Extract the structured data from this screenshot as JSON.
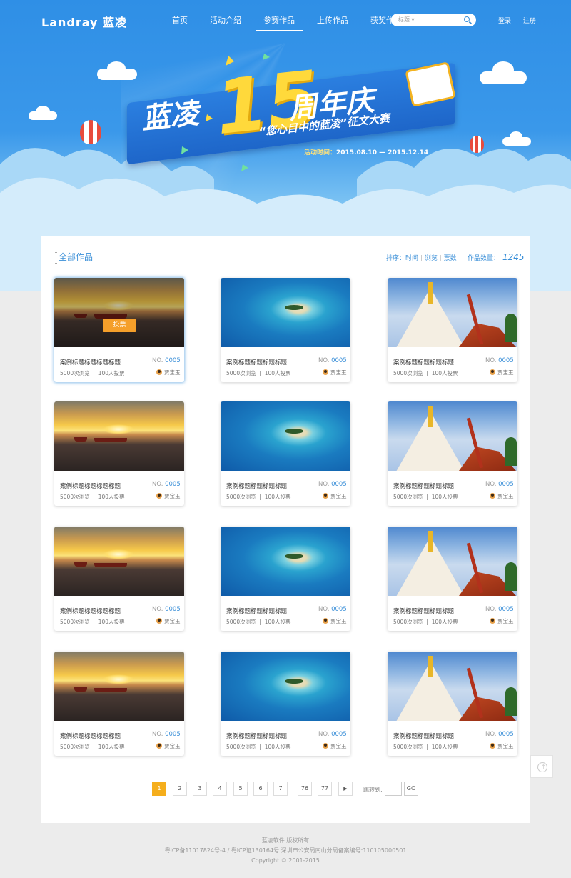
{
  "header": {
    "logo": "Landray 蓝凌",
    "nav": [
      "首页",
      "活动介绍",
      "参赛作品",
      "上传作品",
      "获奖作品"
    ],
    "active_nav": "参赛作品",
    "search": {
      "select_label": "标题 ▾",
      "placeholder": ""
    },
    "login": "登录",
    "separator": "|",
    "register": "注册"
  },
  "banner": {
    "title_left": "蓝凌",
    "title_number": "15",
    "title_right": "周年庆",
    "subtitle": "“您心目中的蓝凌”征文大赛",
    "date_label": "活动时间：",
    "date_range": "2015.08.10 — 2015.12.14"
  },
  "section": {
    "title": "全部作品",
    "sort_label": "排序：",
    "sort_time": "时间",
    "sort_views": "浏览",
    "sort_votes": "票数",
    "sort_sep": "|",
    "count_label": "作品数量：",
    "count_value": "1245"
  },
  "cards": [
    {
      "title": "案例标题标题标题标题",
      "no_prefix": "NO.",
      "no": "0005",
      "views": "5000次浏览",
      "votes": "100人投票",
      "author": "贾宝玉",
      "image": "sunset",
      "vote_label": "投票",
      "sep": "|"
    },
    {
      "title": "案例标题标题标题标题",
      "no_prefix": "NO.",
      "no": "0005",
      "views": "5000次浏览",
      "votes": "100人投票",
      "author": "贾宝玉",
      "image": "island",
      "sep": "|"
    },
    {
      "title": "案例标题标题标题标题",
      "no_prefix": "NO.",
      "no": "0005",
      "views": "5000次浏览",
      "votes": "100人投票",
      "author": "贾宝玉",
      "image": "temple",
      "sep": "|"
    },
    {
      "title": "案例标题标题标题标题",
      "no_prefix": "NO.",
      "no": "0005",
      "views": "5000次浏览",
      "votes": "100人投票",
      "author": "贾宝玉",
      "image": "sunset",
      "sep": "|"
    },
    {
      "title": "案例标题标题标题标题",
      "no_prefix": "NO.",
      "no": "0005",
      "views": "5000次浏览",
      "votes": "100人投票",
      "author": "贾宝玉",
      "image": "island",
      "sep": "|"
    },
    {
      "title": "案例标题标题标题标题",
      "no_prefix": "NO.",
      "no": "0005",
      "views": "5000次浏览",
      "votes": "100人投票",
      "author": "贾宝玉",
      "image": "temple",
      "sep": "|"
    },
    {
      "title": "案例标题标题标题标题",
      "no_prefix": "NO.",
      "no": "0005",
      "views": "5000次浏览",
      "votes": "100人投票",
      "author": "贾宝玉",
      "image": "sunset",
      "sep": "|"
    },
    {
      "title": "案例标题标题标题标题",
      "no_prefix": "NO.",
      "no": "0005",
      "views": "5000次浏览",
      "votes": "100人投票",
      "author": "贾宝玉",
      "image": "island",
      "sep": "|"
    },
    {
      "title": "案例标题标题标题标题",
      "no_prefix": "NO.",
      "no": "0005",
      "views": "5000次浏览",
      "votes": "100人投票",
      "author": "贾宝玉",
      "image": "temple",
      "sep": "|"
    },
    {
      "title": "案例标题标题标题标题",
      "no_prefix": "NO.",
      "no": "0005",
      "views": "5000次浏览",
      "votes": "100人投票",
      "author": "贾宝玉",
      "image": "sunset",
      "sep": "|"
    },
    {
      "title": "案例标题标题标题标题",
      "no_prefix": "NO.",
      "no": "0005",
      "views": "5000次浏览",
      "votes": "100人投票",
      "author": "贾宝玉",
      "image": "island",
      "sep": "|"
    },
    {
      "title": "案例标题标题标题标题",
      "no_prefix": "NO.",
      "no": "0005",
      "views": "5000次浏览",
      "votes": "100人投票",
      "author": "贾宝玉",
      "image": "temple",
      "sep": "|"
    }
  ],
  "pagination": {
    "pages": [
      "1",
      "2",
      "3",
      "4",
      "5",
      "6",
      "7",
      "...",
      "76",
      "77"
    ],
    "current": "1",
    "next_icon": "play-right-icon",
    "next": "▶",
    "jump_label": "跳转到:",
    "go": "GO"
  },
  "back_to_top_icon": "arrow-up-circle-icon",
  "footer": {
    "line1": "蓝凌软件  版权所有",
    "line2": "粤ICP备11017824号-4 / 粤ICP证130164号    深圳市公安局南山分局备案编号:110105000501",
    "line3": "Copyright © 2001-2015"
  },
  "colors": {
    "accent": "#3a8fd8",
    "vote": "#f59f2a",
    "page_current": "#f5ae1c",
    "banner_blue": "#2f8fe6"
  }
}
